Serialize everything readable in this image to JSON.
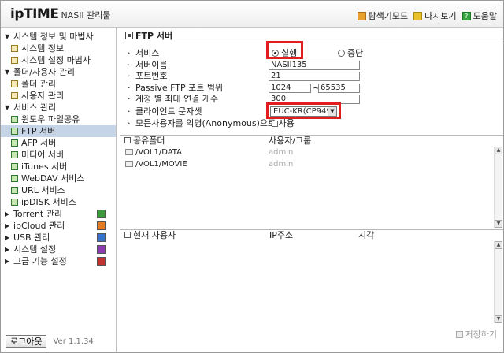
{
  "header": {
    "logo_brand": "ipTIME",
    "logo_model": "NASII 관리툴",
    "links": [
      "탐색기모드",
      "다시보기",
      "도움말"
    ]
  },
  "sidebar": {
    "items": [
      {
        "label": "시스템 정보 및 마법사",
        "expanded": true
      },
      {
        "label": "시스템 정보"
      },
      {
        "label": "시스템 설정 마법사"
      },
      {
        "label": "폴더/사용자 관리",
        "expanded": true
      },
      {
        "label": "폴더 관리"
      },
      {
        "label": "사용자 관리"
      },
      {
        "label": "서비스 관리",
        "expanded": true
      },
      {
        "label": "윈도우 파일공유"
      },
      {
        "label": "FTP 서버",
        "selected": true
      },
      {
        "label": "AFP 서버"
      },
      {
        "label": "미디어 서버"
      },
      {
        "label": "iTunes 서버"
      },
      {
        "label": "WebDAV 서비스"
      },
      {
        "label": "URL 서비스"
      },
      {
        "label": "ipDISK 서비스"
      },
      {
        "label": "Torrent 관리",
        "expanded": false
      },
      {
        "label": "ipCloud 관리",
        "expanded": false
      },
      {
        "label": "USB 관리",
        "expanded": false
      },
      {
        "label": "시스템 설정",
        "expanded": false
      },
      {
        "label": "고급 기능 설정",
        "expanded": false
      }
    ],
    "logout_label": "로그아웃",
    "version": "Ver 1.1.34"
  },
  "main": {
    "title": "FTP 서버",
    "form": {
      "service_label": "서비스",
      "service_on": "실행",
      "service_off": "중단",
      "server_name_label": "서버이름",
      "server_name": "NASII135",
      "port_label": "포트번호",
      "port": "21",
      "passive_label": "Passive FTP 포트 범위",
      "passive_from": "1024",
      "passive_sep": "~",
      "passive_to": "65535",
      "max_conn_label": "계정 별 최대 연결 개수",
      "max_conn": "300",
      "charset_label": "클라이언트 문자셋",
      "charset": "EUC-KR(CP949)",
      "anon_label": "모든사용자를 익명(Anonymous)으로 사용"
    },
    "shares": {
      "headers": [
        "공유폴더",
        "사용자/그룹"
      ],
      "rows": [
        {
          "folder": "/VOL1/DATA",
          "user": "admin"
        },
        {
          "folder": "/VOL1/MOVIE",
          "user": "admin"
        }
      ]
    },
    "current_users": {
      "headers": [
        "현재 사용자",
        "IP주소",
        "시각"
      ]
    },
    "save_label": "저장하기"
  }
}
